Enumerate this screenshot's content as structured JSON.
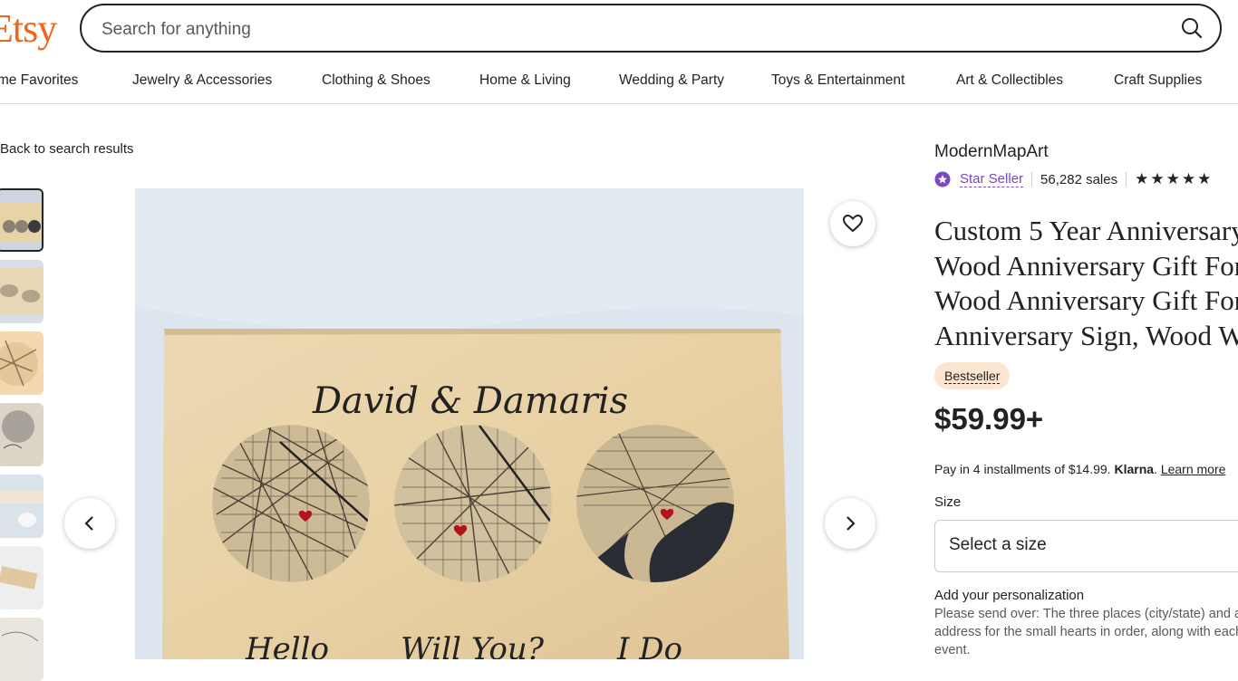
{
  "header": {
    "logo": "Etsy",
    "search_placeholder": "Search for anything"
  },
  "nav": [
    "Home Favorites",
    "Jewelry & Accessories",
    "Clothing & Shoes",
    "Home & Living",
    "Wedding & Party",
    "Toys & Entertainment",
    "Art & Collectibles",
    "Craft Supplies"
  ],
  "back_link": "Back to search results",
  "listing": {
    "image_text": {
      "names": "David & Damaris",
      "captions": [
        "Hello",
        "Will You?",
        "I Do"
      ]
    },
    "seller": "ModernMapArt",
    "star_seller": "Star Seller",
    "sales": "56,282 sales",
    "rating_stars": "★★★★★",
    "title_lines": [
      "Custom 5 Year Anniversary",
      "Wood Anniversary Gift For",
      "Wood Anniversary Gift For",
      "Anniversary Sign, Wood W"
    ],
    "badge": "Bestseller",
    "price": "$59.99+",
    "klarna_text": "Pay in 4 installments of $14.99.",
    "klarna_brand": "Klarna",
    "klarna_link": "Learn more",
    "size_label": "Size",
    "size_placeholder": "Select a size",
    "personalization_label": "Add your personalization",
    "personalization_desc": "Please send over: The three places (city/state) and an address for the small hearts in order, along with each event."
  },
  "colors": {
    "brand": "#f1641e",
    "star_seller_purple": "#7f43c6",
    "badge_bg": "#fde6cf"
  }
}
